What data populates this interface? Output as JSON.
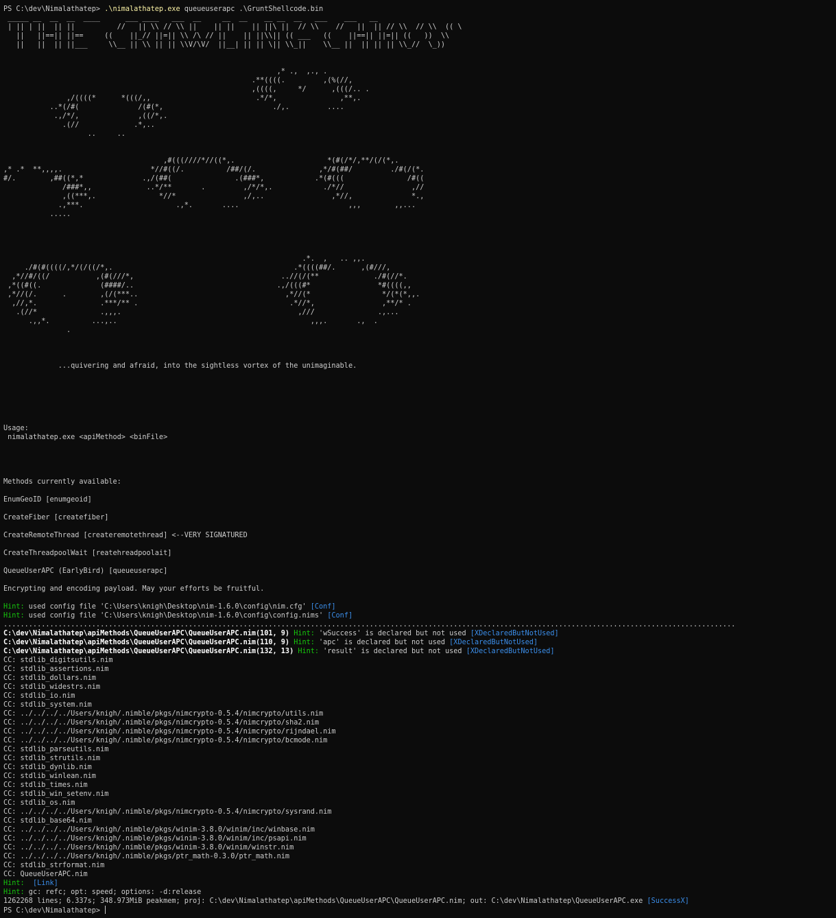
{
  "colors": {
    "background": "#0c0c0c",
    "text": "#cccccc",
    "command": "#f9f1a5",
    "bold": "#ffffff",
    "hint": "#16c60c",
    "tag": "#3b8eea"
  },
  "terminal": {
    "lines": [
      [
        {
          "t": "PS C:\\dev\\Nimalathatep> ",
          "c": "default"
        },
        {
          "t": ".\\nimalathatep.exe",
          "c": "cmd"
        },
        {
          "t": " queueuserapc .\\GruntShellcode.bin",
          "c": "default"
        }
      ],
      [
        {
          "t": " _____ __  __  __  ____      ___ ____   ___  __     __  __    __ __  __   ___    ___   __",
          "c": "default"
        }
      ],
      [
        {
          "t": " | || | ||  || ||          //   || \\\\ // \\\\ ||    || ||    || ||\\ ||  // \\\\    //   ||  || // \\\\  // \\\\  (( \\",
          "c": "default"
        }
      ],
      [
        {
          "t": "   ||   ||==|| ||==     ((    ||_// ||=|| \\\\ /\\ // ||    || ||\\\\|| (( ___   ((    ||==|| ||=|| ((   ))  \\\\",
          "c": "default"
        }
      ],
      [
        {
          "t": "   ||   ||  || ||___     \\\\__ || \\\\ || || \\\\V/\\V/  ||__| || || \\|| \\\\_||    \\\\__ ||  || || || \\\\_//  \\_))",
          "c": "default"
        }
      ],
      [
        {
          "t": "",
          "c": "default"
        }
      ],
      [
        {
          "t": "",
          "c": "default"
        }
      ],
      [
        {
          "t": "                                                                 ,* .,  ,., .",
          "c": "default"
        }
      ],
      [
        {
          "t": "                                                           .**((((.         ,(%(//,",
          "c": "default"
        }
      ],
      [
        {
          "t": "                                                           ,((((,     */      ,(((/.. .",
          "c": "default"
        }
      ],
      [
        {
          "t": "               ,/((((*      *(((/,,                         .*/*,               ,**,.",
          "c": "default"
        }
      ],
      [
        {
          "t": "           ..*(/#(              /(#(*,                          ./,.         ....",
          "c": "default"
        }
      ],
      [
        {
          "t": "            .,/*/,              ,((/*,.",
          "c": "default"
        }
      ],
      [
        {
          "t": "              .(//             .*,..",
          "c": "default"
        }
      ],
      [
        {
          "t": "                    ..     ..",
          "c": "default"
        }
      ],
      [
        {
          "t": "",
          "c": "default"
        }
      ],
      [
        {
          "t": "",
          "c": "default"
        }
      ],
      [
        {
          "t": "                                      ,#(((////*//((*,.                      *(#(/*/,**/(/(*,.",
          "c": "default"
        }
      ],
      [
        {
          "t": ",* .*  **,,,,.                     *//#((/.          /##/(/.               ,*/#(##/         ./#(/(*.",
          "c": "default"
        }
      ],
      [
        {
          "t": "#/.        ,##((*,*              .,/(##(               .(###*,            .*(#(((               /#((",
          "c": "default"
        }
      ],
      [
        {
          "t": "              /###*,,             ..*/**       .         ,/*/*,.            ./*//                ,//",
          "c": "default"
        }
      ],
      [
        {
          "t": "              ,((***,.               *//*                ,/,..                ,*//,              *.,",
          "c": "default"
        }
      ],
      [
        {
          "t": "             .,***.                      .,*.       ....                          ,,,        ,,...",
          "c": "default"
        }
      ],
      [
        {
          "t": "           .....",
          "c": "default"
        }
      ],
      [
        {
          "t": "",
          "c": "default"
        }
      ],
      [
        {
          "t": "",
          "c": "default"
        }
      ],
      [
        {
          "t": "",
          "c": "default"
        }
      ],
      [
        {
          "t": "",
          "c": "default"
        }
      ],
      [
        {
          "t": "                                                                       .*.  ,   .. ,,.",
          "c": "default"
        }
      ],
      [
        {
          "t": "     ./#(#((((/,*/(/((/*,.                                           .*((((##/.      ,(#///,",
          "c": "default"
        }
      ],
      [
        {
          "t": "  ,*//#/((/           ,(#(///*,                                   ..//(/(**             ./#(//*.",
          "c": "default"
        }
      ],
      [
        {
          "t": " ,*((#((.              (####/..                                  .,/(((#*                *#((((,,",
          "c": "default"
        }
      ],
      [
        {
          "t": " ,*//(/.      .        ,(/(***..                                   ,*//(*                 */(*(*,,.",
          "c": "default"
        }
      ],
      [
        {
          "t": "  ,//,*.               .***/** .                                    .*//*,                ,**/* .",
          "c": "default"
        }
      ],
      [
        {
          "t": "   .(//*               .,,,.                                          ,///               .,...",
          "c": "default"
        }
      ],
      [
        {
          "t": "      .,,*.          ...,..                                              ,,,.       .,  .",
          "c": "default"
        }
      ],
      [
        {
          "t": "               .",
          "c": "default"
        }
      ],
      [
        {
          "t": "",
          "c": "default"
        }
      ],
      [
        {
          "t": "",
          "c": "default"
        }
      ],
      [
        {
          "t": "",
          "c": "default"
        }
      ],
      [
        {
          "t": "             ...quivering and afraid, into the sightless vortex of the unimaginable.",
          "c": "default"
        }
      ],
      [
        {
          "t": "",
          "c": "default"
        }
      ],
      [
        {
          "t": "",
          "c": "default"
        }
      ],
      [
        {
          "t": "",
          "c": "default"
        }
      ],
      [
        {
          "t": "",
          "c": "default"
        }
      ],
      [
        {
          "t": "",
          "c": "default"
        }
      ],
      [
        {
          "t": "",
          "c": "default"
        }
      ],
      [
        {
          "t": "Usage:",
          "c": "default"
        }
      ],
      [
        {
          "t": " nimalathatep.exe <apiMethod> <binFile>",
          "c": "default"
        }
      ],
      [
        {
          "t": "",
          "c": "default"
        }
      ],
      [
        {
          "t": "",
          "c": "default"
        }
      ],
      [
        {
          "t": "",
          "c": "default"
        }
      ],
      [
        {
          "t": "",
          "c": "default"
        }
      ],
      [
        {
          "t": "Methods currently available:",
          "c": "default"
        }
      ],
      [
        {
          "t": "",
          "c": "default"
        }
      ],
      [
        {
          "t": "EnumGeoID [enumgeoid]",
          "c": "default"
        }
      ],
      [
        {
          "t": "",
          "c": "default"
        }
      ],
      [
        {
          "t": "CreateFiber [createfiber]",
          "c": "default"
        }
      ],
      [
        {
          "t": "",
          "c": "default"
        }
      ],
      [
        {
          "t": "CreateRemoteThread [createremotethread] <--VERY SIGNATURED",
          "c": "default"
        }
      ],
      [
        {
          "t": "",
          "c": "default"
        }
      ],
      [
        {
          "t": "CreateThreadpoolWait [reatehreadpoolait]",
          "c": "default"
        }
      ],
      [
        {
          "t": "",
          "c": "default"
        }
      ],
      [
        {
          "t": "QueueUserAPC (EarlyBird) [queueuserapc]",
          "c": "default"
        }
      ],
      [
        {
          "t": "",
          "c": "default"
        }
      ],
      [
        {
          "t": "Encrypting and encoding payload. May your efforts be fruitful.",
          "c": "default"
        }
      ],
      [
        {
          "t": "",
          "c": "default"
        }
      ],
      [
        {
          "t": "Hint:",
          "c": "hint"
        },
        {
          "t": " used config file 'C:\\Users\\knigh\\Desktop\\nim-1.6.0\\config\\nim.cfg' ",
          "c": "default"
        },
        {
          "t": "[Conf]",
          "c": "tag"
        }
      ],
      [
        {
          "t": "Hint:",
          "c": "hint"
        },
        {
          "t": " used config file 'C:\\Users\\knigh\\Desktop\\nim-1.6.0\\config\\config.nims' ",
          "c": "default"
        },
        {
          "t": "[Conf]",
          "c": "tag"
        }
      ],
      [
        {
          "t": "..............................................................................................................................................................................",
          "c": "dim"
        }
      ],
      [
        {
          "t": "C:\\dev\\Nimalathatep\\apiMethods\\QueueUserAPC\\QueueUserAPC.nim(101, 9) ",
          "c": "bold"
        },
        {
          "t": "Hint:",
          "c": "hint"
        },
        {
          "t": " 'wSuccess' is declared but not used ",
          "c": "default"
        },
        {
          "t": "[XDeclaredButNotUsed]",
          "c": "tag"
        }
      ],
      [
        {
          "t": "C:\\dev\\Nimalathatep\\apiMethods\\QueueUserAPC\\QueueUserAPC.nim(110, 9) ",
          "c": "bold"
        },
        {
          "t": "Hint:",
          "c": "hint"
        },
        {
          "t": " 'apc' is declared but not used ",
          "c": "default"
        },
        {
          "t": "[XDeclaredButNotUsed]",
          "c": "tag"
        }
      ],
      [
        {
          "t": "C:\\dev\\Nimalathatep\\apiMethods\\QueueUserAPC\\QueueUserAPC.nim(132, 13) ",
          "c": "bold"
        },
        {
          "t": "Hint:",
          "c": "hint"
        },
        {
          "t": " 'result' is declared but not used ",
          "c": "default"
        },
        {
          "t": "[XDeclaredButNotUsed]",
          "c": "tag"
        }
      ],
      [
        {
          "t": "CC: stdlib_digitsutils.nim",
          "c": "default"
        }
      ],
      [
        {
          "t": "CC: stdlib_assertions.nim",
          "c": "default"
        }
      ],
      [
        {
          "t": "CC: stdlib_dollars.nim",
          "c": "default"
        }
      ],
      [
        {
          "t": "CC: stdlib_widestrs.nim",
          "c": "default"
        }
      ],
      [
        {
          "t": "CC: stdlib_io.nim",
          "c": "default"
        }
      ],
      [
        {
          "t": "CC: stdlib_system.nim",
          "c": "default"
        }
      ],
      [
        {
          "t": "CC: ../../../../Users/knigh/.nimble/pkgs/nimcrypto-0.5.4/nimcrypto/utils.nim",
          "c": "default"
        }
      ],
      [
        {
          "t": "CC: ../../../../Users/knigh/.nimble/pkgs/nimcrypto-0.5.4/nimcrypto/sha2.nim",
          "c": "default"
        }
      ],
      [
        {
          "t": "CC: ../../../../Users/knigh/.nimble/pkgs/nimcrypto-0.5.4/nimcrypto/rijndael.nim",
          "c": "default"
        }
      ],
      [
        {
          "t": "CC: ../../../../Users/knigh/.nimble/pkgs/nimcrypto-0.5.4/nimcrypto/bcmode.nim",
          "c": "default"
        }
      ],
      [
        {
          "t": "CC: stdlib_parseutils.nim",
          "c": "default"
        }
      ],
      [
        {
          "t": "CC: stdlib_strutils.nim",
          "c": "default"
        }
      ],
      [
        {
          "t": "CC: stdlib_dynlib.nim",
          "c": "default"
        }
      ],
      [
        {
          "t": "CC: stdlib_winlean.nim",
          "c": "default"
        }
      ],
      [
        {
          "t": "CC: stdlib_times.nim",
          "c": "default"
        }
      ],
      [
        {
          "t": "CC: stdlib_win_setenv.nim",
          "c": "default"
        }
      ],
      [
        {
          "t": "CC: stdlib_os.nim",
          "c": "default"
        }
      ],
      [
        {
          "t": "CC: ../../../../Users/knigh/.nimble/pkgs/nimcrypto-0.5.4/nimcrypto/sysrand.nim",
          "c": "default"
        }
      ],
      [
        {
          "t": "CC: stdlib_base64.nim",
          "c": "default"
        }
      ],
      [
        {
          "t": "CC: ../../../../Users/knigh/.nimble/pkgs/winim-3.8.0/winim/inc/winbase.nim",
          "c": "default"
        }
      ],
      [
        {
          "t": "CC: ../../../../Users/knigh/.nimble/pkgs/winim-3.8.0/winim/inc/psapi.nim",
          "c": "default"
        }
      ],
      [
        {
          "t": "CC: ../../../../Users/knigh/.nimble/pkgs/winim-3.8.0/winim/winstr.nim",
          "c": "default"
        }
      ],
      [
        {
          "t": "CC: ../../../../Users/knigh/.nimble/pkgs/ptr_math-0.3.0/ptr_math.nim",
          "c": "default"
        }
      ],
      [
        {
          "t": "CC: stdlib_strformat.nim",
          "c": "default"
        }
      ],
      [
        {
          "t": "CC: QueueUserAPC.nim",
          "c": "default"
        }
      ],
      [
        {
          "t": "Hint:",
          "c": "hint"
        },
        {
          "t": "  ",
          "c": "default"
        },
        {
          "t": "[Link]",
          "c": "tag"
        }
      ],
      [
        {
          "t": "Hint:",
          "c": "hint"
        },
        {
          "t": " gc: refc; opt: speed; options: -d:release",
          "c": "default"
        }
      ],
      [
        {
          "t": "1262268 lines; 6.337s; 348.973MiB peakmem; proj: C:\\dev\\Nimalathatep\\apiMethods\\QueueUserAPC\\QueueUserAPC.nim; out: C:\\dev\\Nimalathatep\\QueueUserAPC.exe ",
          "c": "default"
        },
        {
          "t": "[SuccessX]",
          "c": "tag"
        }
      ],
      [
        {
          "t": "PS C:\\dev\\Nimalathatep> ",
          "c": "default"
        }
      ]
    ]
  }
}
